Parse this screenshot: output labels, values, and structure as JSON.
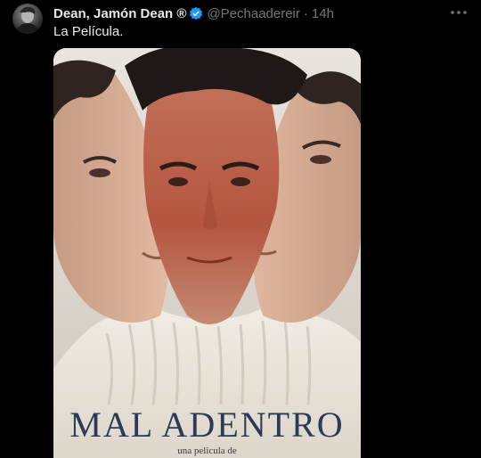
{
  "tweet": {
    "display_name": "Dean, Jamón Dean ®",
    "handle": "@Pechaadereir",
    "separator": "·",
    "time": "14h",
    "text": "La Película.",
    "verified_color": "#1d9bf0"
  },
  "poster": {
    "title": "MAL ADENTRO",
    "subtitle": "una película de"
  },
  "icons": {
    "more": "more-horizontal-icon",
    "verified": "verified-badge-icon"
  }
}
